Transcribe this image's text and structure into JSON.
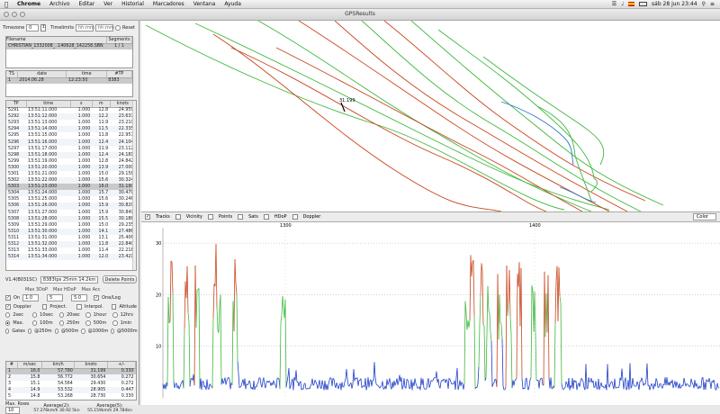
{
  "menubar": {
    "app": "Chrome",
    "items": [
      "Archivo",
      "Editar",
      "Ver",
      "Historial",
      "Marcadores",
      "Ventana",
      "Ayuda"
    ],
    "clock": "sáb 28 jun  23:44"
  },
  "window": {
    "title": "GPSResults"
  },
  "controls": {
    "timezone_label": "Timezone",
    "timezone_value": "0",
    "timelimits_label": "Timelimits",
    "time_from": "hh:mm",
    "time_to": "hh:mm",
    "reset_label": "Reset"
  },
  "files": {
    "headers": [
      "Filename",
      "Segments"
    ],
    "rows": [
      [
        "CHRISTIAN_1332008_..140628_142258.SBN",
        "1 / 1"
      ]
    ]
  },
  "sessions": {
    "headers": [
      "TS",
      "date",
      "time",
      "#TP"
    ],
    "rows": [
      [
        "1",
        "2014.06.28",
        "12:23:50",
        "8383"
      ]
    ]
  },
  "trackpoints": {
    "headers": [
      "TP",
      "time",
      "s",
      "m",
      "knots"
    ],
    "rows": [
      [
        "5291",
        "13:51:11.000",
        "1.000",
        "12.8",
        "24.959"
      ],
      [
        "5292",
        "13:51:12.000",
        "1.000",
        "12.2",
        "23.637"
      ],
      [
        "5293",
        "13:51:13.000",
        "1.000",
        "11.9",
        "23.210"
      ],
      [
        "5294",
        "13:51:14.000",
        "1.000",
        "11.5",
        "22.335"
      ],
      [
        "5295",
        "13:51:15.000",
        "1.000",
        "11.8",
        "22.957"
      ],
      [
        "5296",
        "13:51:16.000",
        "1.000",
        "12.4",
        "24.104"
      ],
      [
        "5297",
        "13:51:17.000",
        "1.000",
        "11.9",
        "23.112"
      ],
      [
        "5298",
        "13:51:18.000",
        "1.000",
        "12.4",
        "24.181"
      ],
      [
        "5299",
        "13:51:19.000",
        "1.000",
        "12.8",
        "24.842"
      ],
      [
        "5300",
        "13:51:20.000",
        "1.000",
        "13.9",
        "27.000"
      ],
      [
        "5301",
        "13:51:21.000",
        "1.000",
        "15.0",
        "29.158"
      ],
      [
        "5302",
        "13:51:22.000",
        "1.000",
        "15.6",
        "30.324"
      ],
      [
        "5303",
        "13:51:23.000",
        "1.000",
        "16.0",
        "31.199"
      ],
      [
        "5304",
        "13:51:24.000",
        "1.000",
        "15.7",
        "30.479"
      ],
      [
        "5305",
        "13:51:25.000",
        "1.000",
        "15.6",
        "30.246"
      ],
      [
        "5306",
        "13:51:26.000",
        "1.000",
        "15.9",
        "30.829"
      ],
      [
        "5307",
        "13:51:27.000",
        "1.000",
        "15.9",
        "30.849"
      ],
      [
        "5308",
        "13:51:28.000",
        "1.000",
        "15.5",
        "30.188"
      ],
      [
        "5309",
        "13:51:29.000",
        "1.000",
        "15.0",
        "29.235"
      ],
      [
        "5310",
        "13:51:30.000",
        "1.000",
        "14.1",
        "27.486"
      ],
      [
        "5311",
        "13:51:31.000",
        "1.000",
        "13.1",
        "25.406"
      ],
      [
        "5312",
        "13:51:32.000",
        "1.000",
        "11.8",
        "22.840"
      ],
      [
        "5313",
        "13:51:33.000",
        "1.000",
        "11.4",
        "22.218"
      ],
      [
        "5314",
        "13:51:34.000",
        "1.000",
        "12.0",
        "23.421"
      ]
    ],
    "selected_index": 12
  },
  "summary": {
    "version": "V1.4(B031SC)",
    "points": "8383tps 25min 14.2km",
    "delete_label": "Delete Points"
  },
  "filters": {
    "labels": [
      "Max 3DoP",
      "Max HDoP",
      "Max Acc"
    ],
    "on_label": "On",
    "values": [
      "1.0",
      "5",
      "5.0"
    ],
    "one_log_label": "One/Log",
    "options_row": [
      "Doppler",
      "Project.",
      "Interpol.",
      "Altitude"
    ],
    "speed_rows": [
      [
        "2sec",
        "10sec",
        "20sec",
        "1hour",
        "12hrs"
      ],
      [
        "Max.",
        "100m",
        "250m",
        "500m",
        "1min"
      ],
      [
        "Gates",
        "@250m",
        "@500m",
        "@1000m",
        "@5000m"
      ]
    ]
  },
  "results": {
    "headers": [
      "#",
      "m/sec",
      "km/h",
      "knots",
      "+/-"
    ],
    "rows": [
      [
        "1",
        "16.0",
        "57.780",
        "31.199",
        "0.330"
      ],
      [
        "2",
        "15.8",
        "56.772",
        "30.654",
        "0.272"
      ],
      [
        "3",
        "15.1",
        "54.564",
        "29.430",
        "0.272"
      ],
      [
        "4",
        "14.9",
        "53.532",
        "28.905",
        "0.447"
      ],
      [
        "5",
        "14.8",
        "53.268",
        "28.730",
        "0.330"
      ]
    ],
    "max_rows_label": "Max. Rows",
    "max_rows_value": "10",
    "avg2_label": "Average(2):",
    "avg2_value": "57.276km/h 30.92 5kn",
    "avg5_label": "Average(5):",
    "avg5_value": "55.159km/h 29.784kn"
  },
  "map": {
    "marker_label": "31.199"
  },
  "mapbar": {
    "items": [
      "Tracks",
      "Vicinity",
      "Points",
      "Sats",
      "HDoP",
      "Doppler"
    ],
    "color_label": "Color"
  },
  "chart_data": {
    "type": "line",
    "ylabel": "",
    "yticks": [
      "10",
      "20",
      "30"
    ],
    "ylim": [
      0,
      33
    ],
    "xticks": [
      "1300",
      "1400"
    ],
    "colors": {
      "low": "#1e3fc8",
      "mid": "#3fb83f",
      "high": "#c8461e"
    }
  }
}
